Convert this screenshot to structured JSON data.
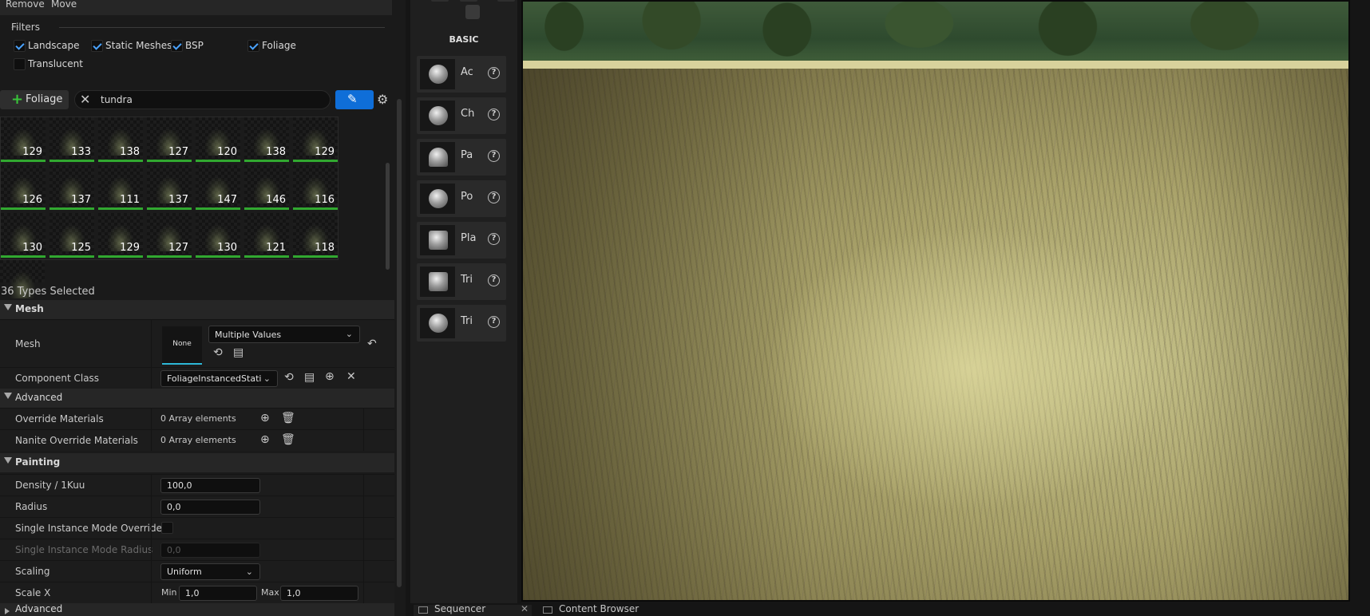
{
  "topbar": {
    "remove": "Remove",
    "move": "Move"
  },
  "filters": {
    "title": "Filters",
    "items": [
      {
        "label": "Landscape",
        "checked": true
      },
      {
        "label": "Static Meshes",
        "checked": true
      },
      {
        "label": "BSP",
        "checked": true
      },
      {
        "label": "Foliage",
        "checked": true
      },
      {
        "label": "Translucent",
        "checked": false
      }
    ]
  },
  "toolbar": {
    "add_label": "Foliage",
    "search_value": "tundra"
  },
  "grid": {
    "counts": [
      "129",
      "133",
      "138",
      "127",
      "120",
      "138",
      "129",
      "126",
      "137",
      "111",
      "137",
      "147",
      "146",
      "116",
      "130",
      "125",
      "129",
      "127",
      "130",
      "121",
      "118"
    ]
  },
  "types_selected": "36 Types Selected",
  "details": {
    "mesh_section": "Mesh",
    "mesh_label": "Mesh",
    "mesh_thumb": "None",
    "mesh_value": "Multiple Values",
    "component_class_label": "Component Class",
    "component_class_value": "FoliageInstancedStati",
    "advanced1": "Advanced",
    "override_materials_label": "Override Materials",
    "override_materials_value": "0 Array elements",
    "nanite_override_label": "Nanite Override Materials",
    "nanite_override_value": "0 Array elements",
    "painting_section": "Painting",
    "density_label": "Density / 1Kuu",
    "density_value": "100,0",
    "radius_label": "Radius",
    "radius_value": "0,0",
    "single_instance_override_label": "Single Instance Mode Override…",
    "single_instance_radius_label": "Single Instance Mode Radius",
    "single_instance_radius_value": "0,0",
    "scaling_label": "Scaling",
    "scaling_value": "Uniform",
    "scalex_label": "Scale X",
    "min_label": "Min",
    "min_value": "1,0",
    "max_label": "Max",
    "max_value": "1,0",
    "advanced2": "Advanced"
  },
  "place_actors": {
    "category": "BASIC",
    "items": [
      {
        "label": "Ac",
        "icon": "actor-icon"
      },
      {
        "label": "Ch",
        "icon": "character-icon"
      },
      {
        "label": "Pa",
        "icon": "pawn-icon"
      },
      {
        "label": "Po",
        "icon": "point-light-icon"
      },
      {
        "label": "Pla",
        "icon": "player-start-icon"
      },
      {
        "label": "Tri",
        "icon": "trigger-box-icon"
      },
      {
        "label": "Tri",
        "icon": "trigger-sphere-icon"
      }
    ]
  },
  "bottom_tabs": [
    {
      "label": "Sequencer"
    },
    {
      "label": "Content Browser"
    }
  ],
  "colors": {
    "accent": "#0f6ed8",
    "check": "#4aa3ff",
    "tile_border": "#31a830"
  }
}
